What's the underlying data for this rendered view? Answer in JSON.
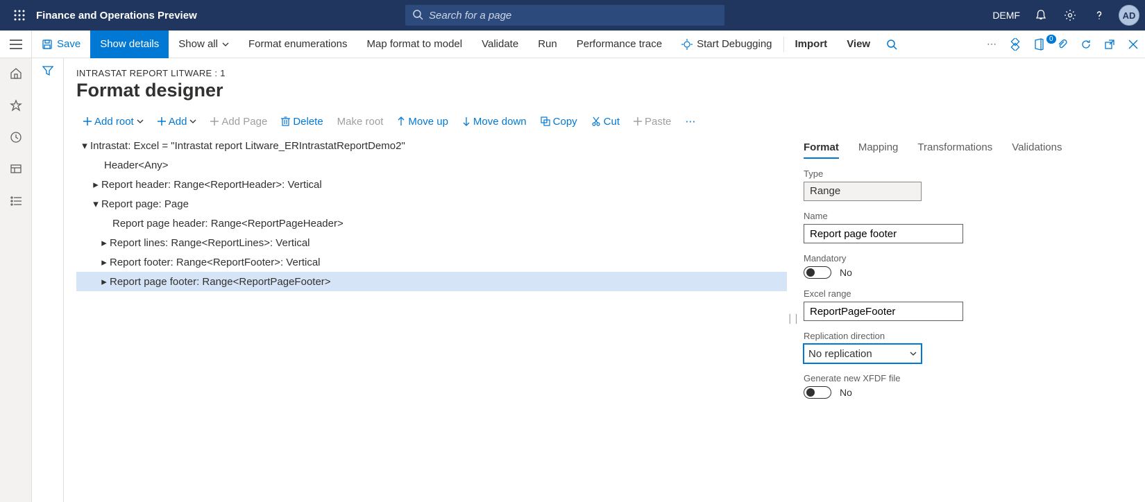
{
  "topbar": {
    "app_title": "Finance and Operations Preview",
    "search_placeholder": "Search for a page",
    "company": "DEMF",
    "avatar": "AD"
  },
  "cmdbar": {
    "save": "Save",
    "show_details": "Show details",
    "show_all": "Show all",
    "format_enum": "Format enumerations",
    "map_format": "Map format to model",
    "validate": "Validate",
    "run": "Run",
    "perf_trace": "Performance trace",
    "start_debug": "Start Debugging",
    "import": "Import",
    "view": "View",
    "badge": "0"
  },
  "breadcrumb": "INTRASTAT REPORT LITWARE : 1",
  "page_title": "Format designer",
  "toolbar2": {
    "add_root": "Add root",
    "add": "Add",
    "add_page": "Add Page",
    "delete": "Delete",
    "make_root": "Make root",
    "move_up": "Move up",
    "move_down": "Move down",
    "copy": "Copy",
    "cut": "Cut",
    "paste": "Paste"
  },
  "tree": {
    "n0": "Intrastat: Excel = \"Intrastat report Litware_ERIntrastatReportDemo2\"",
    "n1": "Header<Any>",
    "n2": "Report header: Range<ReportHeader>: Vertical",
    "n3": "Report page: Page",
    "n4": "Report page header: Range<ReportPageHeader>",
    "n5": "Report lines: Range<ReportLines>: Vertical",
    "n6": "Report footer: Range<ReportFooter>: Vertical",
    "n7": "Report page footer: Range<ReportPageFooter>"
  },
  "tabs": {
    "format": "Format",
    "mapping": "Mapping",
    "transformations": "Transformations",
    "validations": "Validations"
  },
  "panel": {
    "type_label": "Type",
    "type_value": "Range",
    "name_label": "Name",
    "name_value": "Report page footer",
    "mandatory_label": "Mandatory",
    "mandatory_value": "No",
    "excel_range_label": "Excel range",
    "excel_range_value": "ReportPageFooter",
    "repl_label": "Replication direction",
    "repl_value": "No replication",
    "xfdf_label": "Generate new XFDF file",
    "xfdf_value": "No"
  }
}
